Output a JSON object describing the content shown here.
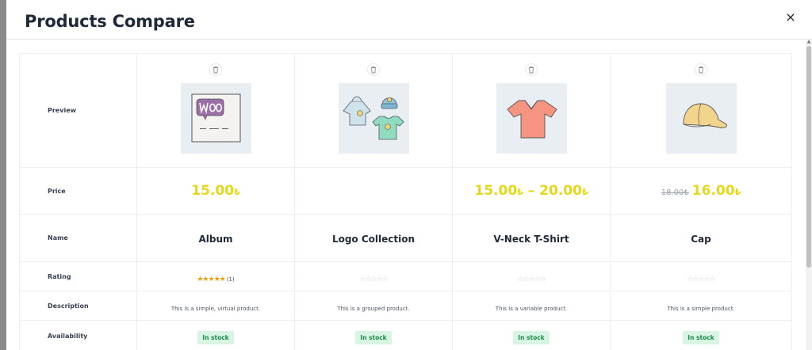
{
  "modal": {
    "title": "Products Compare",
    "close_symbol": "×"
  },
  "rows": {
    "preview": "Preview",
    "price": "Price",
    "name": "Name",
    "rating": "Rating",
    "description": "Description",
    "availability": "Availability"
  },
  "products": [
    {
      "image_icon": "woo-album-image",
      "price_current": "15.00",
      "price_current_currency": "₺",
      "name": "Album",
      "rating_stars": "★★★★★",
      "rating_count": "(1)",
      "description": "This is a simple, virtual product.",
      "availability": "In stock"
    },
    {
      "image_icon": "logo-collection-image",
      "name": "Logo Collection",
      "rating_stars": "☆☆☆☆☆",
      "description": "This is a grouped product.",
      "availability": "In stock"
    },
    {
      "image_icon": "vneck-tshirt-image",
      "price_min": "15.00",
      "price_min_currency": "₺",
      "price_sep": " – ",
      "price_max": "20.00",
      "price_max_currency": "₺",
      "name": "V-Neck T-Shirt",
      "rating_stars": "☆☆☆☆☆",
      "description": "This is a variable product.",
      "availability": "In stock"
    },
    {
      "image_icon": "cap-image",
      "price_old": "18.00₺",
      "price_current": "16.00",
      "price_current_currency": "₺",
      "name": "Cap",
      "rating_stars": "☆☆☆☆☆",
      "description": "This is a simple product.",
      "availability": "In stock"
    }
  ],
  "colors": {
    "price": "#e6d818",
    "in_stock_bg": "#d7f5e2",
    "in_stock_text": "#1c8a4a",
    "star_filled": "#f59e0b"
  }
}
